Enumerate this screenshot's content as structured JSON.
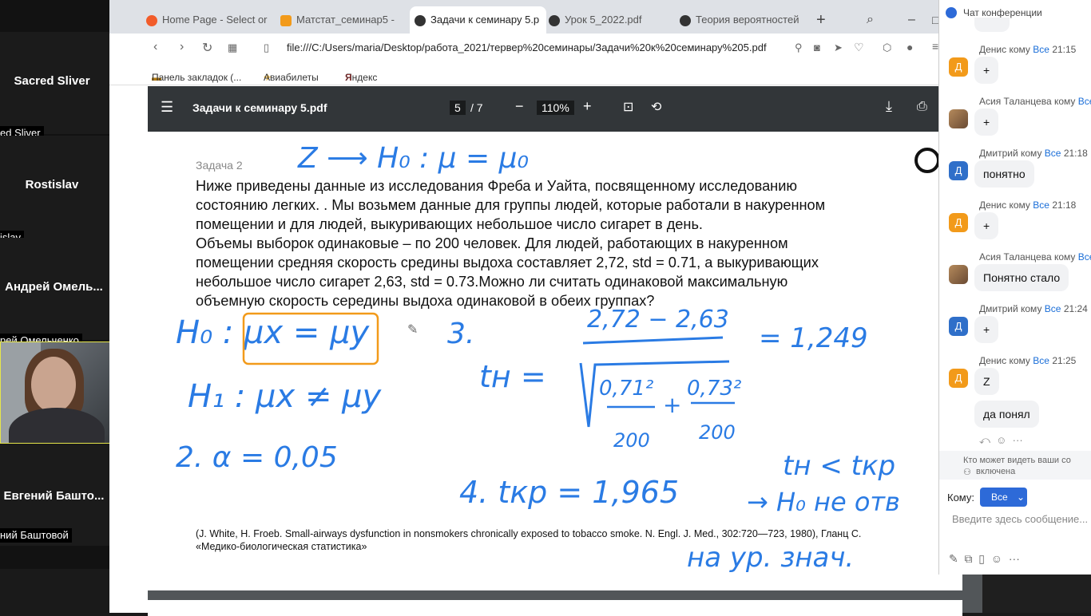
{
  "participants": [
    {
      "name": "Sacred Sliver",
      "label": "ed Sliver"
    },
    {
      "name": "Rostislav",
      "label": "islav"
    },
    {
      "name": "Андрей  Омель...",
      "label": "рей Омельченко"
    },
    {
      "name": "Евгений  Башто...",
      "label": "ний Баштовой"
    }
  ],
  "tabs": [
    {
      "title": "Home Page - Select or",
      "color": "#f25c2a"
    },
    {
      "title": "Матстат_семинар5 -",
      "color": "#f29a1a"
    },
    {
      "title": "Задачи к семинару 5.p",
      "color": "#333333"
    },
    {
      "title": "Урок 5_2022.pdf",
      "color": "#333333"
    },
    {
      "title": "Теория вероятностей",
      "color": "#333333"
    }
  ],
  "address": {
    "url": "file:///C:/Users/maria/Desktop/работа_2021/тервер%20семинары/Задачи%20к%20семинару%205.pdf"
  },
  "bookmarks": [
    "Панель закладок (...",
    "Авиабилеты",
    "Яндекс"
  ],
  "pdf": {
    "title": "Задачи к семинару 5.pdf",
    "page": "5",
    "total": "/ 7",
    "zoom": "110%",
    "task_label": "Задача 2",
    "lines": [
      "Ниже приведены данные из исследования Фреба и Уайта, посвященному исследованию",
      "состоянию легких. . Мы возьмем данные для группы людей, которые работали в накуренном",
      "помещении и для людей, выкуривающих небольшое число сигарет в день.",
      "Объемы выборок одинаковые – по 200 человек. Для людей, работающих в накуренном",
      "помещении средняя скорость средины выдоха составляет 2,72, std = 0.71, а выкуривающих",
      "небольшое число сигарет 2,63, std = 0.73.Можно ли считать одинаковой максимальную",
      "объемную скорость середины выдоха одинаковой в обеих группах?"
    ],
    "reference_1": "(J. White, H. Froeb. Small-airways dysfunction in nonsmokers chronically exposed to tobacco smoke. N. Engl. J. Med., 302:720—723, 1980), Гланц С.",
    "reference_2": "«Медико-биологическая статистика»"
  },
  "handwriting": {
    "top": "Z ⟶ H₀ : μ = μ₀",
    "h0": "H₀ : μx = μy",
    "h1": "H₁ : μx ≠ μy",
    "alpha": "2.  α = 0,05",
    "step3": "3.",
    "tn": "tн =",
    "numerator": "2,72 − 2,63",
    "result": "= 1,249",
    "frac1_num": "0,71²",
    "frac1_den": "200",
    "plus": "+",
    "frac2_num": "0,73²",
    "frac2_den": "200",
    "step4": "4.  tкр = 1,965",
    "compare": "tн < tкр",
    "conclusion": "→ H₀ не отв",
    "level": "на ур. знач."
  },
  "chat": {
    "title": "Чат конференции",
    "messages": [
      {
        "sender": "Денис",
        "to": "кому",
        "target": "Все",
        "time": "21:15",
        "text": "+",
        "avatar": "Д",
        "style": "orange"
      },
      {
        "sender": "Асия Таланцева",
        "to": "кому",
        "target": "Все",
        "time": "",
        "text": "+",
        "avatar": "",
        "style": "photo"
      },
      {
        "sender": "Дмитрий",
        "to": "кому",
        "target": "Все",
        "time": "21:18",
        "text": "понятно",
        "avatar": "Д",
        "style": "blue"
      },
      {
        "sender": "Денис",
        "to": "кому",
        "target": "Все",
        "time": "21:18",
        "text": "+",
        "avatar": "Д",
        "style": "orange"
      },
      {
        "sender": "Асия Таланцева",
        "to": "кому",
        "target": "Все",
        "time": "",
        "text": "Понятно стало",
        "avatar": "",
        "style": "photo"
      },
      {
        "sender": "Дмитрий",
        "to": "кому",
        "target": "Все",
        "time": "21:24",
        "text": "+",
        "avatar": "Д",
        "style": "blue"
      },
      {
        "sender": "Денис",
        "to": "кому",
        "target": "Все",
        "time": "21:25",
        "text": "Z",
        "avatar": "Д",
        "style": "orange"
      }
    ],
    "extra_bubble": "да понял",
    "privacy_note_1": "Кто может видеть ваши со",
    "privacy_note_2": "включена",
    "to_label": "Кому:",
    "to_value": "Все",
    "input_placeholder": "Введите здесь сообщение..."
  },
  "colors": {
    "ink": "#2a7be4",
    "highlight": "#f29a1a",
    "accent": "#1a6ed8"
  }
}
